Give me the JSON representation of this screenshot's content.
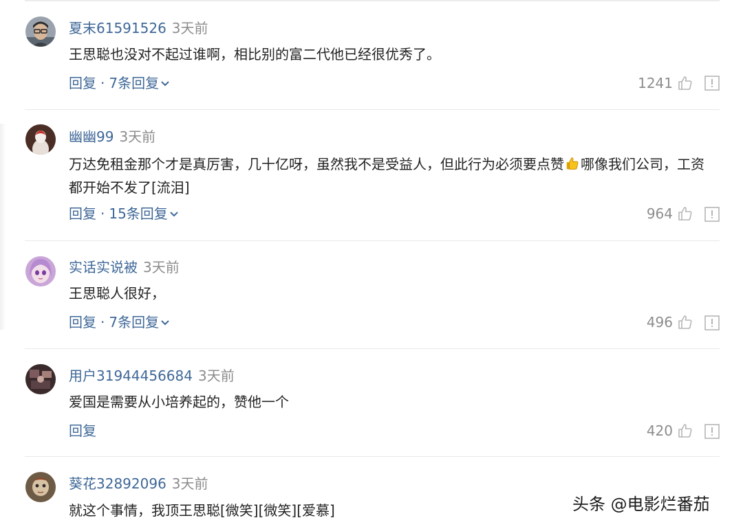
{
  "comments": [
    {
      "username": "夏末61591526",
      "time": "3天前",
      "text": "王思聪也没对不起过谁啊，相比别的富二代他已经很优秀了。",
      "reply_label": "回复",
      "reply_count": "7条回复",
      "likes": "1241",
      "avatar": "man-with-glasses-avatar"
    },
    {
      "username": "幽幽99",
      "time": "3天前",
      "text_before_emoji": "万达免租金那个才是真厉害，几十亿呀，虽然我不是受益人，但此行为必须要点赞",
      "emoji": "thumbs-up-emoji",
      "text_after_emoji": "哪像我们公司，工资都开始不发了[流泪]",
      "reply_label": "回复",
      "reply_count": "15条回复",
      "likes": "964",
      "avatar": "white-figure-dark-avatar"
    },
    {
      "username": "实话实说被",
      "time": "3天前",
      "text": "王思聪人很好，",
      "reply_label": "回复",
      "reply_count": "7条回复",
      "likes": "496",
      "avatar": "anime-girl-avatar"
    },
    {
      "username": "用户31944456684",
      "time": "3天前",
      "text": "爱国是需要从小培养起的，赞他一个",
      "reply_label": "回复",
      "likes": "420",
      "avatar": "dark-pattern-avatar"
    },
    {
      "username": "葵花32892096",
      "time": "3天前",
      "text": "就这个事情，我顶王思聪[微笑][微笑][爱慕]",
      "avatar": "doll-figure-avatar"
    }
  ],
  "separator": "·",
  "watermark": "头条 @电影烂番茄",
  "colors": {
    "username": "#3e6797",
    "action": "#3e6797",
    "muted": "#8c8c8c",
    "text": "#222222"
  }
}
